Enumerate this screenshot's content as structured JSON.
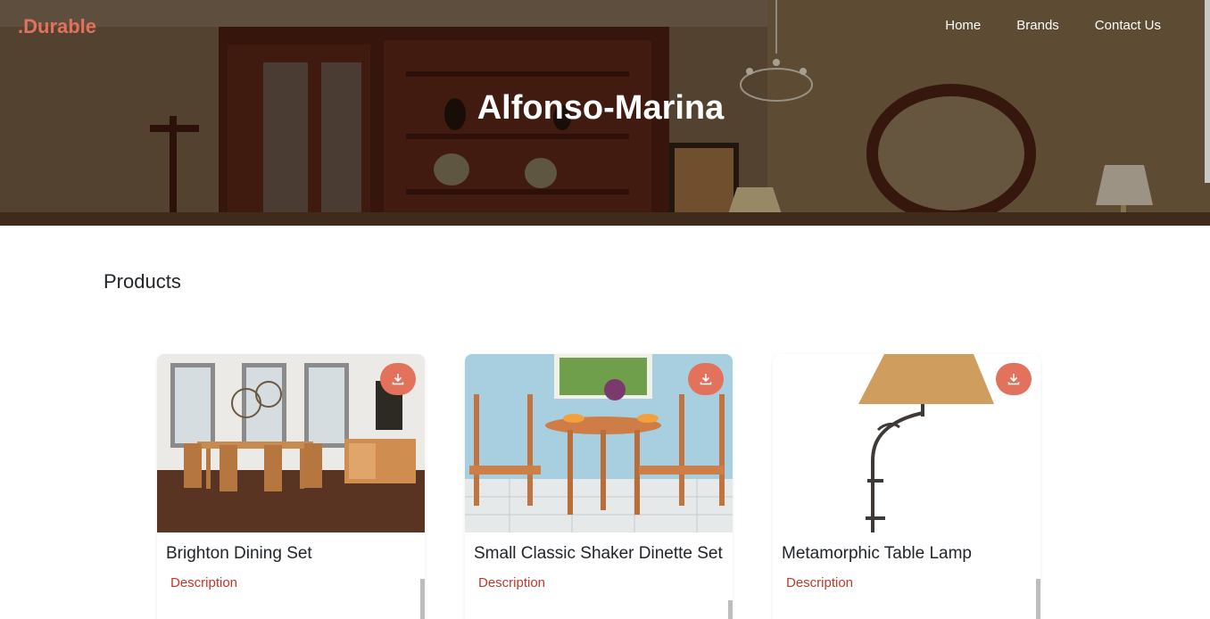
{
  "header": {
    "brand": ".Durable",
    "nav": [
      "Home",
      "Brands",
      "Contact Us"
    ],
    "hero_title": "Alfonso-Marina"
  },
  "products": {
    "section_title": "Products",
    "items": [
      {
        "title": "Brighton Dining Set",
        "description": "Description"
      },
      {
        "title": "Small Classic Shaker Dinette Set",
        "description": "Description"
      },
      {
        "title": "Metamorphic Table Lamp",
        "description": "Description"
      }
    ]
  },
  "colors": {
    "accent": "#e2725b",
    "description": "#c0392b"
  },
  "icons": {
    "download": "download-icon"
  }
}
